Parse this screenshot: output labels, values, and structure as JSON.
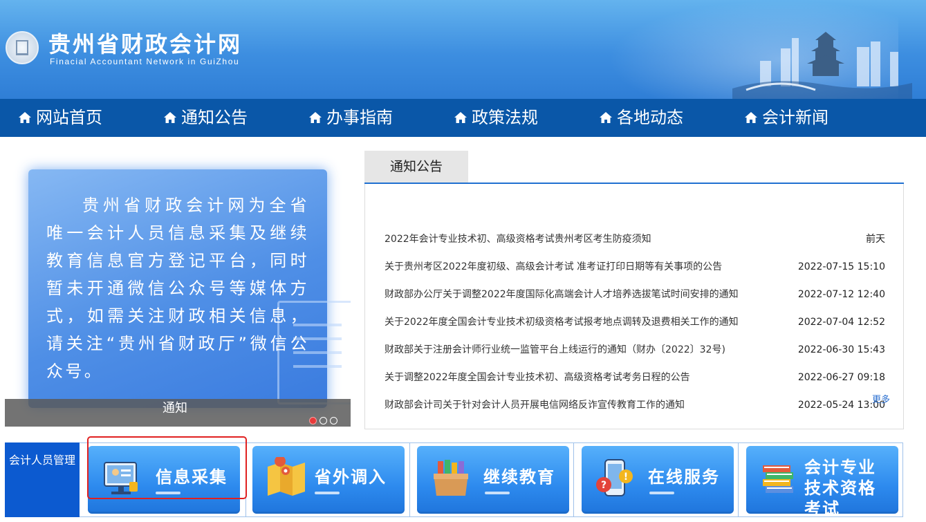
{
  "header": {
    "title": "贵州省财政会计网",
    "subtitle": "Finacial  Accountant Network in GuiZhou"
  },
  "nav": {
    "items": [
      "网站首页",
      "通知公告",
      "办事指南",
      "政策法规",
      "各地动态",
      "会计新闻"
    ]
  },
  "slide": {
    "text": "贵州省财政会计网为全省唯一会计人员信息采集及继续教育信息官方登记平台，同时暂未开通微信公众号等媒体方式，如需关注财政相关信息，请关注“贵州省财政厅”微信公众号。",
    "caption": "通知",
    "active_dot": 1,
    "dot_count": 3
  },
  "notices": {
    "tab": "通知公告",
    "items": [
      {
        "title": "2022年会计专业技术初、高级资格考试贵州考区考生防疫须知",
        "date": "前天"
      },
      {
        "title": "关于贵州考区2022年度初级、高级会计考试 准考证打印日期等有关事项的公告",
        "date": "2022-07-15 15:10"
      },
      {
        "title": "财政部办公厅关于调整2022年度国际化高端会计人才培养选拔笔试时间安排的通知",
        "date": "2022-07-12 12:40"
      },
      {
        "title": "关于2022年度全国会计专业技术初级资格考试报考地点调转及退费相关工作的通知",
        "date": "2022-07-04 12:52"
      },
      {
        "title": "财政部关于注册会计师行业统一监管平台上线运行的通知（财办〔2022〕32号)",
        "date": "2022-06-30 15:43"
      },
      {
        "title": "关于调整2022年度全国会计专业技术初、高级资格考试考务日程的公告",
        "date": "2022-06-27 09:18"
      },
      {
        "title": "财政部会计司关于针对会计人员开展电信网络反诈宣传教育工作的通知",
        "date": "2022-05-24 13:00"
      }
    ],
    "more": "更多"
  },
  "bottom": {
    "label": "会计人员管理",
    "tiles": [
      "信息采集",
      "省外调入",
      "继续教育",
      "在线服务",
      "会计专业技术资格考试"
    ]
  },
  "colors": {
    "nav_bg": "#0a57a8",
    "tile_blue": "#2d8aee",
    "highlight_red": "#e02020"
  }
}
